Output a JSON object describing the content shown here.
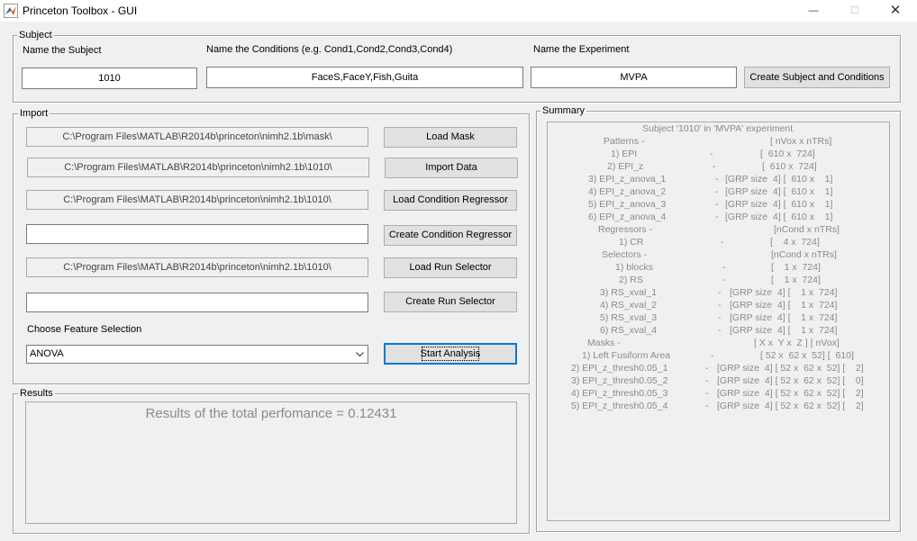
{
  "window": {
    "title": "Princeton Toolbox - GUI",
    "minimize_glyph": "—",
    "maximize_glyph": "☐",
    "close_glyph": "✕"
  },
  "subject_panel": {
    "title": "Subject",
    "name_subject_label": "Name the Subject",
    "name_subject_value": "1010",
    "name_conditions_label": "Name the Conditions (e.g. Cond1,Cond2,Cond3,Cond4)",
    "name_conditions_value": "FaceS,FaceY,Fish,Guita",
    "name_experiment_label": "Name the Experiment",
    "name_experiment_value": "MVPA",
    "create_button": "Create Subject and Conditions"
  },
  "import_panel": {
    "title": "Import",
    "mask_path": "C:\\Program Files\\MATLAB\\R2014b\\princeton\\nimh2.1b\\mask\\",
    "load_mask": "Load Mask",
    "data_path": "C:\\Program Files\\MATLAB\\R2014b\\princeton\\nimh2.1b\\1010\\",
    "import_data": "Import Data",
    "regressor_path": "C:\\Program Files\\MATLAB\\R2014b\\princeton\\nimh2.1b\\1010\\",
    "load_condition_regressor": "Load Condition Regressor",
    "create_regressor_path": "",
    "create_condition_regressor": "Create Condition Regressor",
    "selector_path": "C:\\Program Files\\MATLAB\\R2014b\\princeton\\nimh2.1b\\1010\\",
    "load_run_selector": "Load Run Selector",
    "create_selector_path": "",
    "create_run_selector": "Create Run Selector",
    "feature_selection_label": "Choose Feature Selection",
    "feature_selection_value": "ANOVA",
    "start_analysis": "Start Analysis"
  },
  "results_panel": {
    "title": "Results",
    "text": "Results of the total perfomance = 0.12431"
  },
  "summary_panel": {
    "title": "Summary",
    "lines": [
      "Subject '1010' in 'MVPA' experiment",
      "Patterns -",
      "[ nVox x nTRs]",
      "1) EPI",
      "-",
      "[  610 x  724]",
      "2) EPI_z",
      "-",
      "[  610 x  724]",
      "3) EPI_z_anova_1",
      "-",
      "[GRP size  4] [  610 x    1]",
      "4) EPI_z_anova_2",
      "-",
      "[GRP size  4] [  610 x    1]",
      "5) EPI_z_anova_3",
      "-",
      "[GRP size  4] [  610 x    1]",
      "6) EPI_z_anova_4",
      "-",
      "[GRP size  4] [  610 x    1]",
      "Regressors -",
      "[nCond x nTRs]",
      "1) CR",
      "-",
      "[    4 x  724]",
      "Selectors -",
      "[nCond x nTRs]",
      "1) blocks",
      "-",
      "[    1 x  724]",
      "2) RS",
      "-",
      "[    1 x  724]",
      "3) RS_xval_1",
      "-",
      "[GRP size  4] [    1 x  724]",
      "4) RS_xval_2",
      "-",
      "[GRP size  4] [    1 x  724]",
      "5) RS_xval_3",
      "-",
      "[GRP size  4] [    1 x  724]",
      "6) RS_xval_4",
      "-",
      "[GRP size  4] [    1 x  724]",
      "Masks -",
      "[ X x  Y x  Z ] [ nVox]",
      "1) Left Fusiform Area",
      "-",
      "[ 52 x  62 x  52] [  610]",
      "2) EPI_z_thresh0.05_1",
      "-",
      "[GRP size  4] [ 52 x  62 x  52] [    2]",
      "3) EPI_z_thresh0.05_2",
      "-",
      "[GRP size  4] [ 52 x  62 x  52] [    0]",
      "4) EPI_z_thresh0.05_3",
      "-",
      "[GRP size  4] [ 52 x  62 x  52] [    2]",
      "5) EPI_z_thresh0.05_4",
      "-",
      "[GRP size  4] [ 52 x  62 x  52] [    2]"
    ]
  }
}
